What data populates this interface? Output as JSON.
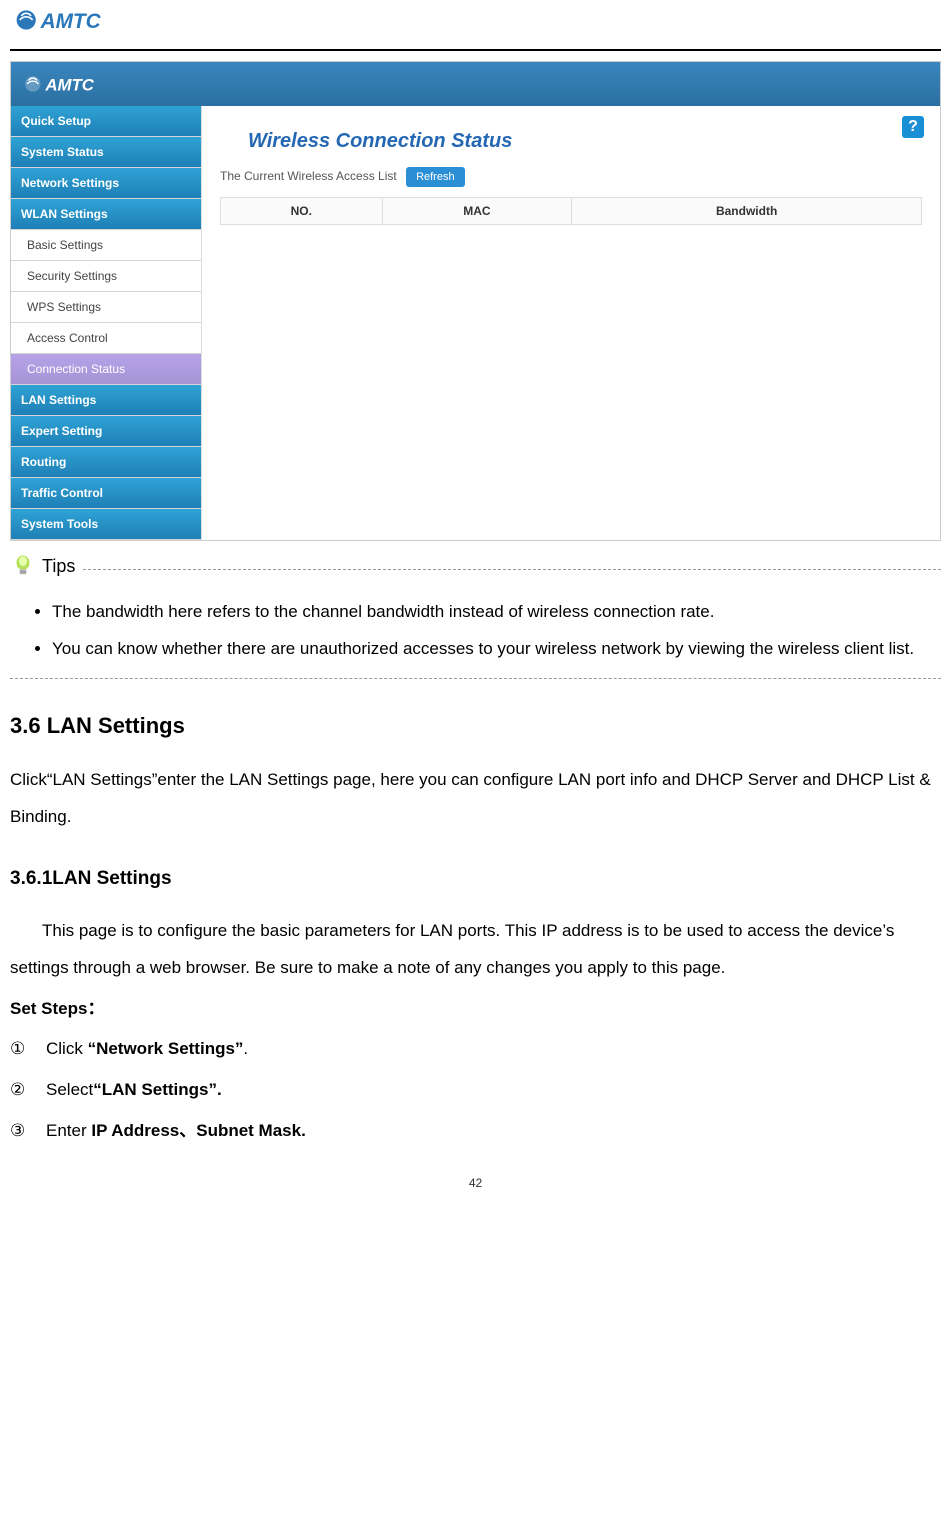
{
  "brand": "AMTC",
  "doc_header_logo_alt": "AMTC logo",
  "screenshot": {
    "sidebar": {
      "items": [
        {
          "label": "Quick Setup",
          "type": "head"
        },
        {
          "label": "System Status",
          "type": "head"
        },
        {
          "label": "Network Settings",
          "type": "head"
        },
        {
          "label": "WLAN Settings",
          "type": "head"
        },
        {
          "label": "Basic Settings",
          "type": "sub"
        },
        {
          "label": "Security Settings",
          "type": "sub"
        },
        {
          "label": "WPS Settings",
          "type": "sub"
        },
        {
          "label": "Access Control",
          "type": "sub"
        },
        {
          "label": "Connection Status",
          "type": "sub",
          "selected": true
        },
        {
          "label": "LAN Settings",
          "type": "head"
        },
        {
          "label": "Expert Setting",
          "type": "head"
        },
        {
          "label": "Routing",
          "type": "head"
        },
        {
          "label": "Traffic Control",
          "type": "head"
        },
        {
          "label": "System Tools",
          "type": "head"
        }
      ]
    },
    "content": {
      "title": "Wireless Connection Status",
      "access_list_label": "The Current Wireless Access List",
      "refresh_label": "Refresh",
      "help_symbol": "?",
      "table_headers": [
        "NO.",
        "MAC",
        "Bandwidth"
      ]
    }
  },
  "tips": {
    "label": "Tips",
    "items": [
      "The bandwidth here refers to the channel bandwidth instead of wireless connection rate.",
      "You can know whether there are unauthorized accesses to your wireless network by viewing the wireless client list."
    ]
  },
  "section": {
    "heading": "3.6 LAN Settings",
    "intro": "Click“LAN Settings”enter the LAN Settings page, here you can configure LAN port info and DHCP Server and DHCP List & Binding."
  },
  "subsection": {
    "heading": "3.6.1LAN Settings",
    "para": "This page is to configure the basic parameters for LAN ports. This IP address is to be used to access the device’s settings through a web browser. Be sure to make a note of any changes you apply to this page.",
    "steps_label": "Set Steps：",
    "steps": [
      {
        "marker": "①",
        "pre": "Click ",
        "bold": "“Network Settings”",
        "post": "."
      },
      {
        "marker": "②",
        "pre": "Select",
        "bold": "“LAN Settings”.",
        "post": ""
      },
      {
        "marker": "③",
        "pre": "Enter ",
        "bold": "IP Address、Subnet Mask.",
        "post": ""
      }
    ]
  },
  "page_number": "42"
}
